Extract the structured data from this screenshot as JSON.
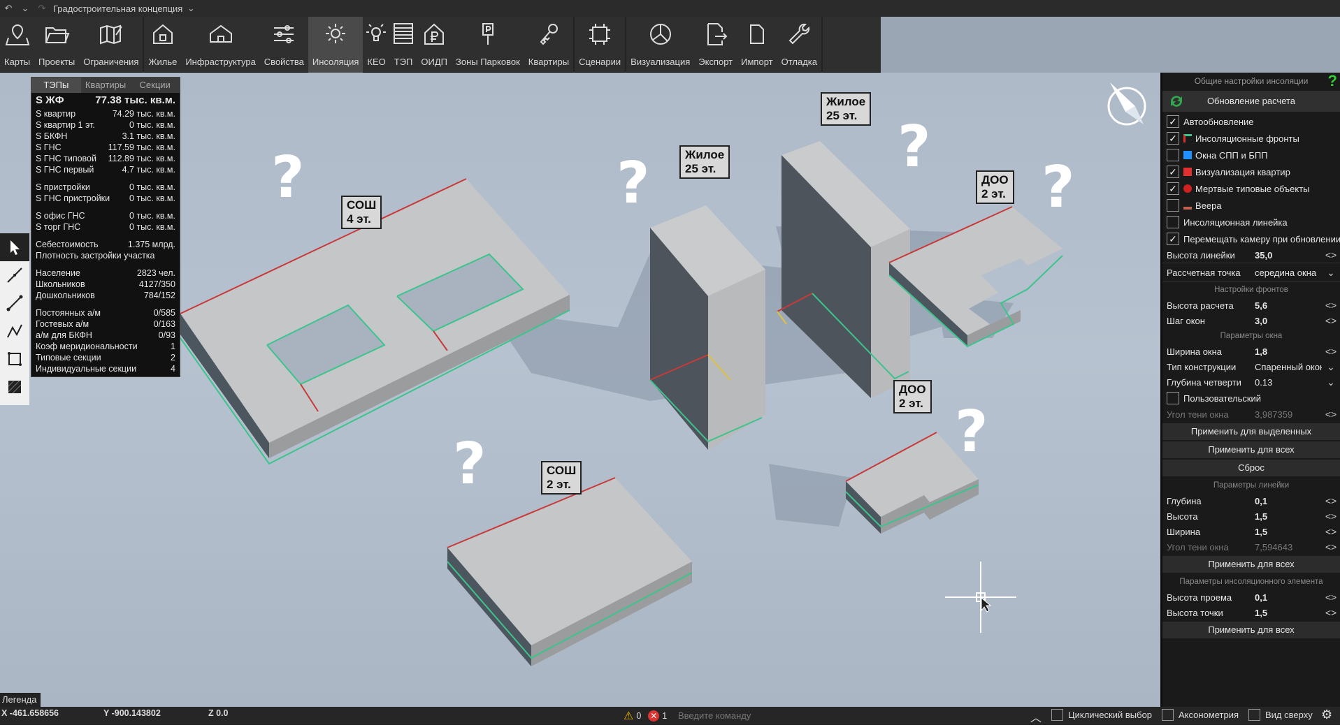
{
  "titlebar": {
    "title": "Градостроительная концепция"
  },
  "toolbar": {
    "items": [
      {
        "label": "Карты",
        "icon": "map-pin-icon"
      },
      {
        "label": "Проекты",
        "icon": "folder-icon"
      },
      {
        "label": "Ограничения",
        "icon": "map-edit-icon"
      },
      {
        "label": "Жилье",
        "icon": "house-icon"
      },
      {
        "label": "Инфраструктура",
        "icon": "building-icon"
      },
      {
        "label": "Свойства",
        "icon": "sliders-icon"
      },
      {
        "label": "Инсоляция",
        "icon": "sun-icon"
      },
      {
        "label": "КЕО",
        "icon": "bulb-icon"
      },
      {
        "label": "ТЭП",
        "icon": "list-icon"
      },
      {
        "label": "ОИДП",
        "icon": "ruble-house-icon"
      },
      {
        "label": "Зоны Парковок",
        "icon": "parking-sign-icon"
      },
      {
        "label": "Квартиры",
        "icon": "key-icon"
      },
      {
        "label": "Сценарии",
        "icon": "frame-icon"
      },
      {
        "label": "Визуализация",
        "icon": "pie-icon"
      },
      {
        "label": "Экспорт",
        "icon": "export-icon"
      },
      {
        "label": "Импорт",
        "icon": "document-icon"
      },
      {
        "label": "Отладка",
        "icon": "wrench-icon"
      }
    ],
    "active": "Инсоляция"
  },
  "tep_panel": {
    "tabs": [
      "ТЭПы",
      "Квартиры",
      "Секции"
    ],
    "active_tab": "ТЭПы",
    "header": {
      "label": "S ЖФ",
      "value": "77.38 тыс. кв.м."
    },
    "group1": [
      {
        "label": "S квартир",
        "value": "74.29 тыс. кв.м."
      },
      {
        "label": "S квартир 1 эт.",
        "value": "0 тыс. кв.м."
      },
      {
        "label": "S БКФН",
        "value": "3.1 тыс. кв.м."
      },
      {
        "label": "S ГНС",
        "value": "117.59 тыс. кв.м."
      },
      {
        "label": "S ГНС типовой",
        "value": "112.89 тыс. кв.м."
      },
      {
        "label": "S ГНС первый",
        "value": "4.7 тыс. кв.м."
      }
    ],
    "group2": [
      {
        "label": "S пристройки",
        "value": "0 тыс. кв.м."
      },
      {
        "label": "S ГНС пристройки",
        "value": "0 тыс. кв.м."
      }
    ],
    "group3": [
      {
        "label": "S офис ГНС",
        "value": "0 тыс. кв.м."
      },
      {
        "label": "S торг ГНС",
        "value": "0 тыс. кв.м."
      }
    ],
    "group4": [
      {
        "label": "Себестоимость",
        "value": "1.375 млрд."
      },
      {
        "label": "Плотность застройки участка",
        "value": ""
      }
    ],
    "group5": [
      {
        "label": "Население",
        "value": "2823 чел."
      },
      {
        "label": "Школьников",
        "value": "4127/350"
      },
      {
        "label": "Дошкольников",
        "value": "784/152"
      }
    ],
    "group6": [
      {
        "label": "Постоянных а/м",
        "value": "0/585"
      },
      {
        "label": "Гостевых а/м",
        "value": "0/163"
      },
      {
        "label": "а/м для БКФН",
        "value": "0/93"
      },
      {
        "label": "Коэф меридиональности",
        "value": "1"
      },
      {
        "label": "Типовые секции",
        "value": "2"
      },
      {
        "label": "Индивидуальные секции",
        "value": "4"
      }
    ]
  },
  "tools": [
    "pointer-tool-icon",
    "line-tool-icon",
    "segment-tool-icon",
    "polyline-tool-icon",
    "rectangle-tool-icon",
    "hatch-tool-icon"
  ],
  "buildings": [
    {
      "name": "sosh-4",
      "label": "СОШ\n4 эт."
    },
    {
      "name": "zhiloe-1",
      "label": "Жилое\n25 эт."
    },
    {
      "name": "zhiloe-2",
      "label": "Жилое\n25 эт."
    },
    {
      "name": "doo-1",
      "label": "ДОО\n2 эт."
    },
    {
      "name": "doo-2",
      "label": "ДОО\n2 эт."
    },
    {
      "name": "sosh-2",
      "label": "СОШ\n2 эт."
    }
  ],
  "question_mark": "?",
  "legend": "Легенда",
  "right_panel": {
    "title": "Общие настройки инсоляции",
    "help": "?",
    "update_button": "Обновление расчета",
    "checks": [
      {
        "label": "Автообновление",
        "checked": true,
        "swatch": ""
      },
      {
        "label": "Инсоляционные фронты",
        "checked": true,
        "swatch": "fronts"
      },
      {
        "label": "Окна СПП и БПП",
        "checked": false,
        "swatch": "#1e90ff"
      },
      {
        "label": "Визуализация квартир",
        "checked": true,
        "swatch": "#e03030"
      },
      {
        "label": "Мертвые типовые объекты",
        "checked": true,
        "swatch": "dot"
      },
      {
        "label": "Веера",
        "checked": false,
        "swatch": "fan"
      },
      {
        "label": "Инсоляционная линейка",
        "checked": false,
        "swatch": ""
      },
      {
        "label": "Перемещать камеру при обновлении",
        "checked": true,
        "swatch": ""
      }
    ],
    "ruler_height": {
      "label": "Высота линейки",
      "value": "35,0"
    },
    "calc_point": {
      "label": "Рассчетная точка",
      "value": "середина окна"
    },
    "fronts_title": "Настройки фронтов",
    "calc_height": {
      "label": "Высота расчета",
      "value": "5,6"
    },
    "window_step": {
      "label": "Шаг окон",
      "value": "3,0"
    },
    "window_params_title": "Параметры окна",
    "window_width": {
      "label": "Ширина окна",
      "value": "1,8"
    },
    "construction_type": {
      "label": "Тип конструкции",
      "value": "Спаренный окон"
    },
    "quarter_depth": {
      "label": "Глубина четверти",
      "value": "0.13"
    },
    "custom": {
      "label": "Пользовательский",
      "checked": false
    },
    "window_shadow_angle": {
      "label": "Угол тени окна",
      "value": "3,987359"
    },
    "apply_selected": "Применить для выделенных",
    "apply_all_1": "Применить для всех",
    "reset": "Сброс",
    "ruler_params_title": "Параметры линейки",
    "depth": {
      "label": "Глубина",
      "value": "0,1"
    },
    "height": {
      "label": "Высота",
      "value": "1,5"
    },
    "width": {
      "label": "Ширина",
      "value": "1,5"
    },
    "ruler_shadow_angle": {
      "label": "Угол тени окна",
      "value": "7,594643"
    },
    "apply_all_2": "Применить для всех",
    "element_params_title": "Параметры инсоляционного элемента",
    "opening_height": {
      "label": "Высота проема",
      "value": "0,1"
    },
    "point_height": {
      "label": "Высота точки",
      "value": "1,5"
    },
    "apply_all_3": "Применить для всех"
  },
  "statusbar": {
    "x": "X -461.658656",
    "y": "Y -900.143802",
    "z": "Z 0.0",
    "warnings": "0",
    "errors": "1",
    "command_placeholder": "Введите команду",
    "cyclic": "Циклический выбор",
    "axonometry": "Аксонометрия",
    "top_view": "Вид сверху"
  },
  "colors": {
    "accent_green": "#2fa84f",
    "front_red": "#c83a3a",
    "front_green": "#3cc48c",
    "building": "#c6c8ca"
  }
}
